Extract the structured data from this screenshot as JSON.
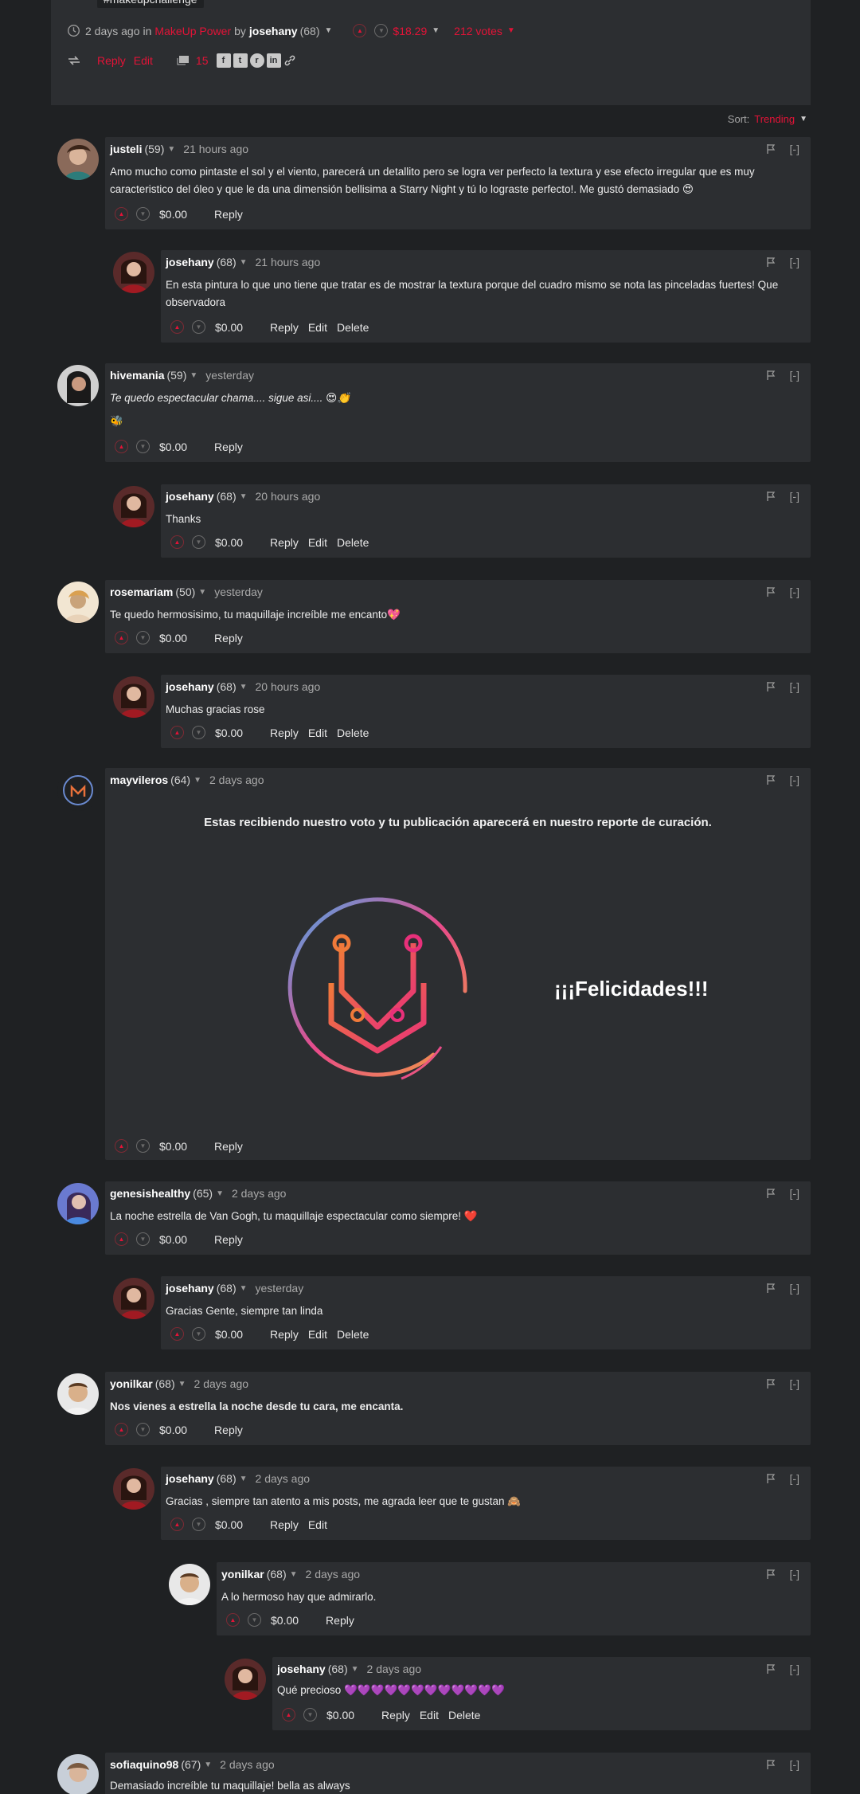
{
  "post": {
    "tag": "#makeupchallenge",
    "time": "2 days ago",
    "in_label": "in",
    "community": "MakeUp Power",
    "by_label": "by",
    "author": "josehany",
    "rep": "(68)",
    "payout": "$18.29",
    "votes": "212 votes",
    "reply": "Reply",
    "edit": "Edit",
    "comments": "15",
    "share_icons": [
      "facebook-icon",
      "twitter-icon",
      "reddit-icon",
      "linkedin-icon",
      "link-icon"
    ]
  },
  "sort": {
    "label": "Sort:",
    "value": "Trending"
  },
  "comments": [
    {
      "author": "justeli",
      "rep": "(59)",
      "time": "21 hours ago",
      "body": "Amo mucho como pintaste el sol y el viento, parecerá un detallito pero se logra ver perfecto la textura y ese efecto irregular que es muy caracteristico del óleo y que le da una dimensión bellisima a Starry Night y tú lo lograste perfecto!. Me gustó demasiado 😍",
      "payout": "$0.00",
      "actions": [
        "Reply"
      ]
    },
    {
      "author": "josehany",
      "rep": "(68)",
      "time": "21 hours ago",
      "body": "En esta pintura lo que uno tiene que tratar es de mostrar la textura porque del cuadro mismo se nota las pinceladas fuertes! Que observadora",
      "payout": "$0.00",
      "actions": [
        "Reply",
        "Edit",
        "Delete"
      ]
    },
    {
      "author": "hivemania",
      "rep": "(59)",
      "time": "yesterday",
      "body": "Te quedo espectacular chama.... sigue asi.... 😍👏",
      "body2": "🐝",
      "payout": "$0.00",
      "actions": [
        "Reply"
      ]
    },
    {
      "author": "josehany",
      "rep": "(68)",
      "time": "20 hours ago",
      "body": "Thanks",
      "payout": "$0.00",
      "actions": [
        "Reply",
        "Edit",
        "Delete"
      ]
    },
    {
      "author": "rosemariam",
      "rep": "(50)",
      "time": "yesterday",
      "body": "Te quedo hermosisimo, tu maquillaje increíble me encanto💖",
      "payout": "$0.00",
      "actions": [
        "Reply"
      ]
    },
    {
      "author": "josehany",
      "rep": "(68)",
      "time": "20 hours ago",
      "body": "Muchas gracias rose",
      "payout": "$0.00",
      "actions": [
        "Reply",
        "Edit",
        "Delete"
      ]
    },
    {
      "author": "mayvileros",
      "rep": "(64)",
      "time": "2 days ago",
      "title": "Estas recibiendo nuestro voto y tu publicación aparecerá en nuestro reporte de curación.",
      "felicidades": "¡¡¡Felicidades!!!",
      "payout": "$0.00",
      "actions": [
        "Reply"
      ]
    },
    {
      "author": "genesishealthy",
      "rep": "(65)",
      "time": "2 days ago",
      "body": "La noche estrella de Van Gogh, tu maquillaje espectacular como siempre! ❤️",
      "payout": "$0.00",
      "actions": [
        "Reply"
      ]
    },
    {
      "author": "josehany",
      "rep": "(68)",
      "time": "yesterday",
      "body": "Gracias Gente, siempre tan linda",
      "payout": "$0.00",
      "actions": [
        "Reply",
        "Edit",
        "Delete"
      ]
    },
    {
      "author": "yonilkar",
      "rep": "(68)",
      "time": "2 days ago",
      "body": "Nos vienes a estrella la noche desde tu cara, me encanta.",
      "payout": "$0.00",
      "actions": [
        "Reply"
      ]
    },
    {
      "author": "josehany",
      "rep": "(68)",
      "time": "2 days ago",
      "body": "Gracias , siempre tan atento a mis posts, me agrada leer que te gustan 🙈",
      "payout": "$0.00",
      "actions": [
        "Reply",
        "Edit"
      ]
    },
    {
      "author": "yonilkar",
      "rep": "(68)",
      "time": "2 days ago",
      "body": "A lo hermoso hay que admirarlo.",
      "payout": "$0.00",
      "actions": [
        "Reply"
      ]
    },
    {
      "author": "josehany",
      "rep": "(68)",
      "time": "2 days ago",
      "body": "Qué precioso 💜💜💜💜💜💜💜💜💜💜💜💜",
      "payout": "$0.00",
      "actions": [
        "Reply",
        "Edit",
        "Delete"
      ]
    },
    {
      "author": "sofiaquino98",
      "rep": "(67)",
      "time": "2 days ago",
      "body": "Demasiado increíble tu maquillaje! bella as always",
      "payout": "",
      "actions": []
    }
  ],
  "ui": {
    "flag": "flag-icon",
    "collapse": "[-]"
  }
}
